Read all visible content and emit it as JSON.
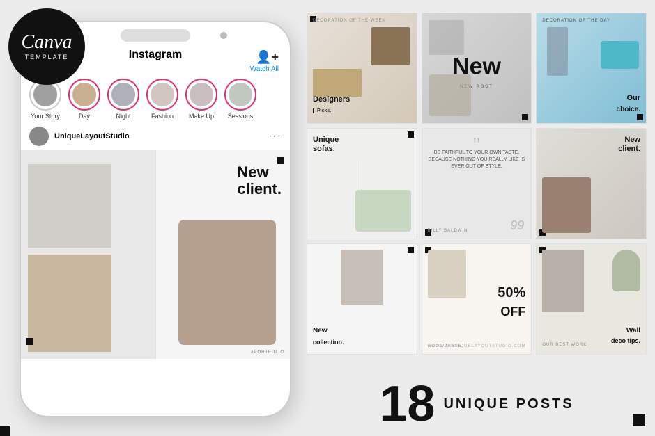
{
  "badge": {
    "canva": "Canva",
    "template": "TEMPLATE"
  },
  "phone": {
    "platform": "Instagram",
    "watch_all": "Watch All",
    "stories": [
      {
        "label": "Your Story"
      },
      {
        "label": "Day"
      },
      {
        "label": "Night"
      },
      {
        "label": "Fashion"
      },
      {
        "label": "Make Up"
      },
      {
        "label": "Sessions"
      }
    ],
    "username": "UniqueLayoutStudio",
    "post_text_line1": "New",
    "post_text_line2": "client.",
    "portfolio_label": "#PORTFOLIO"
  },
  "grid": {
    "posts": [
      {
        "id": 1,
        "top_label": "DECORATION OF THE WEEK",
        "main_text": "Designers",
        "main_text2": "Picks.",
        "corner": "tl"
      },
      {
        "id": 2,
        "main_text": "New",
        "sub_text": "NEW POST",
        "corner": "br"
      },
      {
        "id": 3,
        "top_label": "DECORATION OF THE DAY",
        "main_text": "Our",
        "main_text2": "choice.",
        "corner": "br"
      },
      {
        "id": 4,
        "main_text": "Unique",
        "main_text2": "sofas.",
        "corner": "tr"
      },
      {
        "id": 5,
        "quote": "BE FAITHFUL TO YOUR OWN TASTE, BECAUSE NOTHING YOU REALLY LIKE IS EVER OUT OF STYLE.",
        "author": "BILLY BALDWIN",
        "num": "99",
        "corner": "bl"
      },
      {
        "id": 6,
        "main_text": "New",
        "main_text2": "client.",
        "corner": "bl"
      },
      {
        "id": 7,
        "main_text": "New",
        "main_text2": "collection.",
        "corner": "tr"
      },
      {
        "id": 8,
        "percent": "50%",
        "off": "OFF",
        "sub_label": "GOOD TASTE",
        "corner": "tl"
      },
      {
        "id": 9,
        "sub_label": "OUR BEST WORK",
        "main_text": "Wall",
        "main_text2": "deco tips.",
        "corner": "tl"
      }
    ]
  },
  "bottom": {
    "number": "18",
    "label": "UNIQUE POSTS"
  }
}
